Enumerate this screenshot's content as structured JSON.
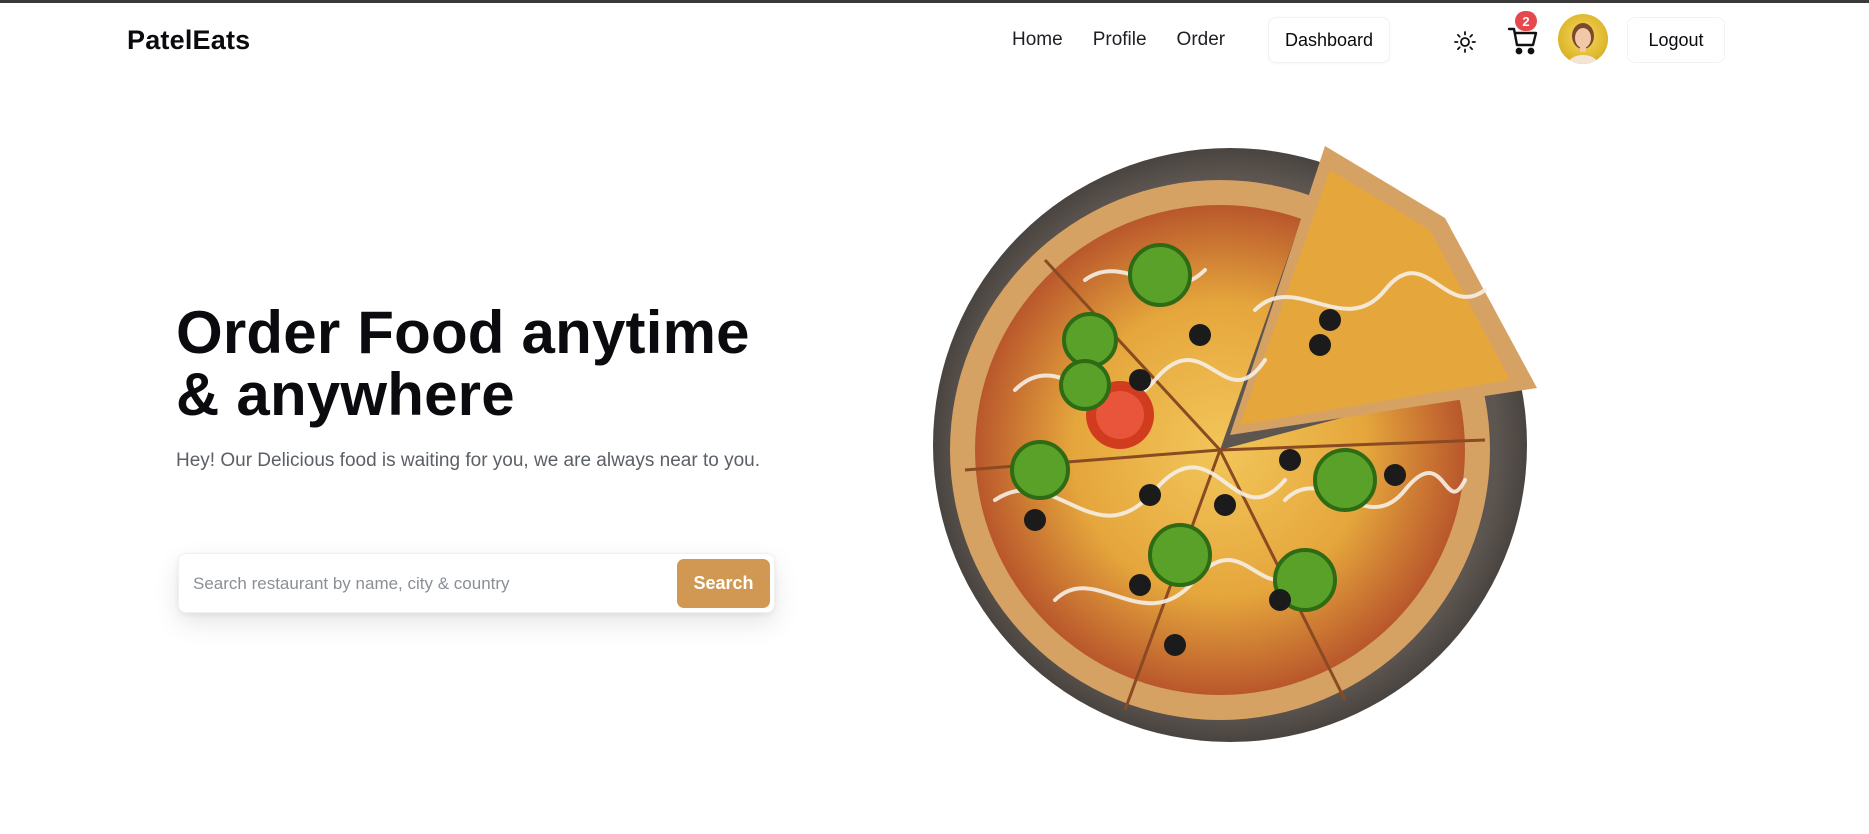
{
  "nav": {
    "brand": "PatelEats",
    "links": [
      {
        "label": "Home"
      },
      {
        "label": "Profile"
      },
      {
        "label": "Order"
      }
    ],
    "dashboard_label": "Dashboard",
    "cart_count": "2",
    "logout_label": "Logout"
  },
  "hero": {
    "title_line1": "Order Food anytime",
    "title_line2": "& anywhere",
    "subtitle": "Hey! Our Delicious food is waiting for you, we are always near to you.",
    "search_placeholder": "Search restaurant by name, city & country",
    "search_value": "",
    "search_button": "Search"
  },
  "icons": {
    "theme": "sun-icon",
    "cart": "cart-icon"
  },
  "colors": {
    "accent": "#d19854",
    "badge": "#e5484d",
    "text": "#0b0b0f",
    "muted": "#5b5f66"
  }
}
